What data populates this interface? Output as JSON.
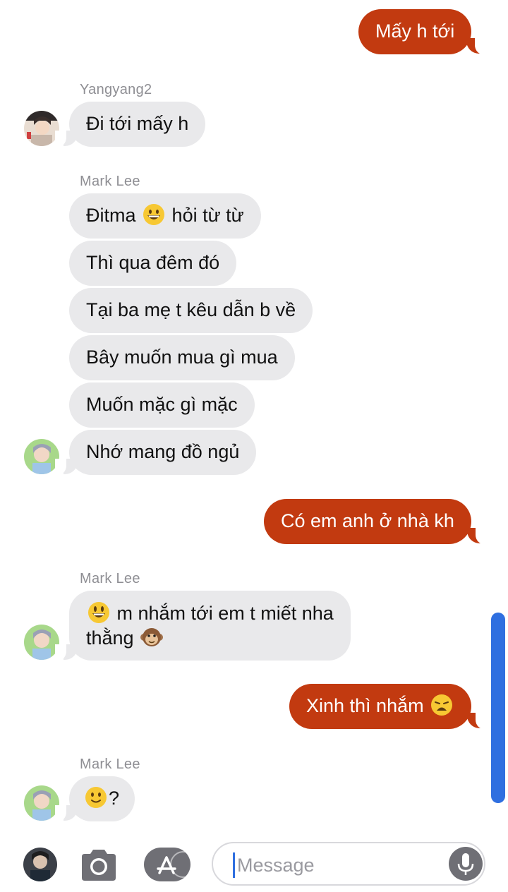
{
  "conversation": {
    "messages": [
      {
        "sender": "",
        "direction": "out",
        "text": "Mấy h tới"
      },
      {
        "sender": "Yangyang2",
        "direction": "in",
        "text": "Đi tới mấy h"
      },
      {
        "sender": "Mark Lee",
        "direction": "in",
        "text_before": "Đitma",
        "emoji": "grinning-face",
        "text_after": "hỏi từ từ"
      },
      {
        "sender": "Mark Lee",
        "direction": "in",
        "text": "Thì qua đêm đó"
      },
      {
        "sender": "Mark Lee",
        "direction": "in",
        "text": "Tại ba mẹ t kêu dẫn b về"
      },
      {
        "sender": "Mark Lee",
        "direction": "in",
        "text": "Bây muốn mua gì mua"
      },
      {
        "sender": "Mark Lee",
        "direction": "in",
        "text": "Muốn mặc gì mặc"
      },
      {
        "sender": "Mark Lee",
        "direction": "in",
        "text": "Nhớ mang đồ ngủ"
      },
      {
        "sender": "",
        "direction": "out",
        "text": "Có em anh ở nhà kh"
      },
      {
        "sender": "Mark Lee",
        "direction": "in",
        "emoji": "grinning-face-big-eyes",
        "line1": "m nhắm tới em t miết nha",
        "line2": "thằng",
        "emoji2": "monkey-face"
      },
      {
        "sender": "",
        "direction": "out",
        "text": "Xinh thì nhắm",
        "emoji": "weary-face"
      },
      {
        "sender": "Mark Lee",
        "direction": "in",
        "emoji": "slightly-smiling-face",
        "text": "?"
      }
    ]
  },
  "labels": {
    "yangyang": "Yangyang2",
    "mark1": "Mark Lee",
    "mark2": "Mark Lee",
    "mark3": "Mark Lee"
  },
  "msg": {
    "m1": "Mấy h tới",
    "m2": "Đi tới mấy h",
    "m3a": "Đitma",
    "m3b": "hỏi từ từ",
    "m4": "Thì qua đêm đó",
    "m5": "Tại ba mẹ t kêu dẫn b về",
    "m6": "Bây muốn mua gì mua",
    "m7": "Muốn mặc gì mặc",
    "m8": "Nhớ mang đồ ngủ",
    "m9": "Có em anh ở nhà kh",
    "m10a": "m nhắm tới em t miết nha",
    "m10b": "thằng",
    "m11": "Xinh thì nhắm",
    "m12": "?"
  },
  "composer": {
    "placeholder": "Message"
  },
  "colors": {
    "outgoing_bubble": "#c23a10",
    "incoming_bubble": "#e9e9eb",
    "scrollbar": "#2f6fe0"
  },
  "icons": [
    "profile-avatar",
    "camera-icon",
    "app-store-icon",
    "microphone-icon"
  ]
}
